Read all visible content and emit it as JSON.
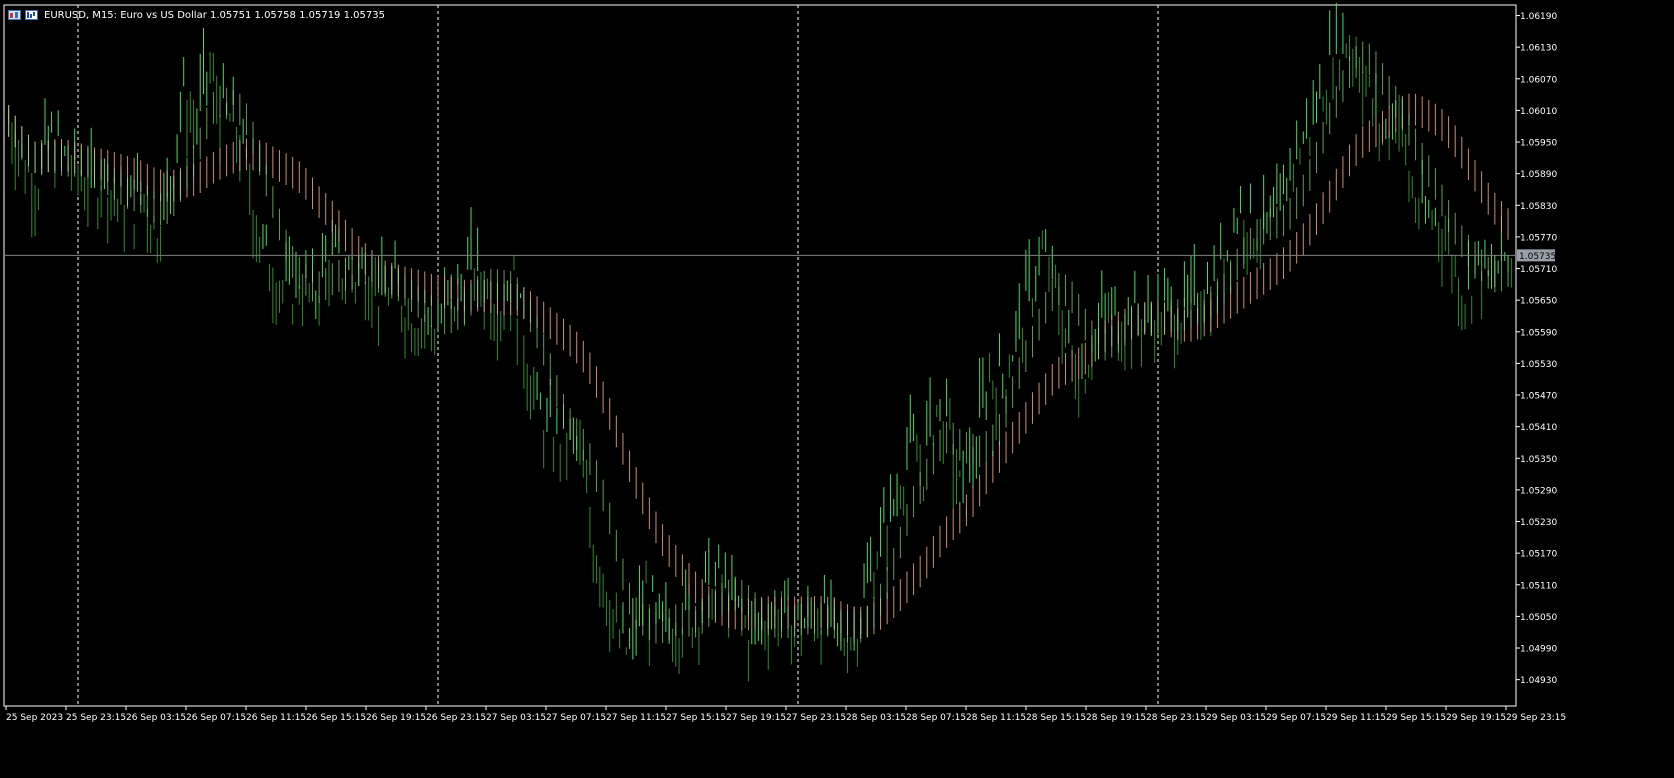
{
  "header": {
    "symbol_title": "EURUSD, M15:  Euro vs US Dollar  1.05751 1.05758 1.05719 1.05735"
  },
  "colors": {
    "background": "#000000",
    "axis": "#ffffff",
    "grid": "#ffffff",
    "bull_candle": "#4cd964",
    "bear_candle": "#2e8b2e",
    "ma_slow": "#f4a582",
    "ma_fast": "#8ee07a",
    "price_line": "#808080",
    "price_label_bg": "#9aa0aa"
  },
  "chart_data": {
    "type": "candlestick",
    "symbol": "EURUSD",
    "timeframe": "M15",
    "current_price": "1.05735",
    "ylim": [
      1.0488,
      1.0621
    ],
    "y_ticks": [
      "1.06190",
      "1.06130",
      "1.06070",
      "1.06010",
      "1.05950",
      "1.05890",
      "1.05830",
      "1.05770",
      "1.05710",
      "1.05650",
      "1.05590",
      "1.05530",
      "1.05470",
      "1.05410",
      "1.05350",
      "1.05290",
      "1.05230",
      "1.05170",
      "1.05110",
      "1.05050",
      "1.04990",
      "1.04930"
    ],
    "x_ticks": [
      "25 Sep 2023",
      "25 Sep 23:15",
      "26 Sep 03:15",
      "26 Sep 07:15",
      "26 Sep 11:15",
      "26 Sep 15:15",
      "26 Sep 19:15",
      "26 Sep 23:15",
      "27 Sep 03:15",
      "27 Sep 07:15",
      "27 Sep 11:15",
      "27 Sep 15:15",
      "27 Sep 19:15",
      "27 Sep 23:15",
      "28 Sep 03:15",
      "28 Sep 07:15",
      "28 Sep 11:15",
      "28 Sep 15:15",
      "28 Sep 19:15",
      "28 Sep 23:15",
      "29 Sep 03:15",
      "29 Sep 07:15",
      "29 Sep 11:15",
      "29 Sep 15:15",
      "29 Sep 19:15",
      "29 Sep 23:15"
    ],
    "day_separators": [
      "25 Sep 23:15",
      "26 Sep 23:15",
      "27 Sep 23:15",
      "28 Sep 23:15"
    ],
    "close_path": [
      [
        0,
        1.0599
      ],
      [
        4,
        1.0591
      ],
      [
        8,
        1.0587
      ],
      [
        12,
        1.0596
      ],
      [
        16,
        1.0592
      ],
      [
        20,
        1.0589
      ],
      [
        24,
        1.0586
      ],
      [
        28,
        1.0588
      ],
      [
        32,
        1.0584
      ],
      [
        36,
        1.0582
      ],
      [
        40,
        1.0585
      ],
      [
        44,
        1.0578
      ],
      [
        48,
        1.0586
      ],
      [
        52,
        1.0604
      ],
      [
        56,
        1.0598
      ],
      [
        60,
        1.0609
      ],
      [
        64,
        1.06
      ],
      [
        68,
        1.0598
      ],
      [
        72,
        1.0588
      ],
      [
        76,
        1.0575
      ],
      [
        80,
        1.057
      ],
      [
        84,
        1.0566
      ],
      [
        88,
        1.0569
      ],
      [
        92,
        1.0565
      ],
      [
        96,
        1.0574
      ],
      [
        100,
        1.0571
      ],
      [
        104,
        1.0569
      ],
      [
        108,
        1.0571
      ],
      [
        112,
        1.0565
      ],
      [
        116,
        1.0568
      ],
      [
        120,
        1.0563
      ],
      [
        124,
        1.0561
      ],
      [
        128,
        1.0559
      ],
      [
        132,
        1.0564
      ],
      [
        136,
        1.0567
      ],
      [
        140,
        1.0572
      ],
      [
        144,
        1.0567
      ],
      [
        148,
        1.0564
      ],
      [
        152,
        1.0568
      ],
      [
        156,
        1.0555
      ],
      [
        160,
        1.0543
      ],
      [
        164,
        1.0539
      ],
      [
        168,
        1.0538
      ],
      [
        172,
        1.0537
      ],
      [
        176,
        1.052
      ],
      [
        180,
        1.0512
      ],
      [
        184,
        1.05
      ],
      [
        188,
        1.0498
      ],
      [
        192,
        1.051
      ],
      [
        196,
        1.0502
      ],
      [
        200,
        1.0503
      ],
      [
        204,
        1.0505
      ],
      [
        208,
        1.0506
      ],
      [
        212,
        1.0512
      ],
      [
        216,
        1.0511
      ],
      [
        220,
        1.0506
      ],
      [
        224,
        1.0501
      ],
      [
        228,
        1.0503
      ],
      [
        232,
        1.0507
      ],
      [
        236,
        1.0504
      ],
      [
        240,
        1.0503
      ],
      [
        244,
        1.0506
      ],
      [
        248,
        1.0503
      ],
      [
        252,
        1.05
      ],
      [
        256,
        1.0503
      ],
      [
        260,
        1.0513
      ],
      [
        264,
        1.052
      ],
      [
        268,
        1.0527
      ],
      [
        272,
        1.0538
      ],
      [
        276,
        1.0533
      ],
      [
        280,
        1.0545
      ],
      [
        284,
        1.0541
      ],
      [
        288,
        1.0526
      ],
      [
        292,
        1.0536
      ],
      [
        296,
        1.0551
      ],
      [
        300,
        1.0549
      ],
      [
        304,
        1.0557
      ],
      [
        308,
        1.0565
      ],
      [
        312,
        1.0574
      ],
      [
        316,
        1.0568
      ],
      [
        320,
        1.0557
      ],
      [
        324,
        1.0551
      ],
      [
        328,
        1.0557
      ],
      [
        332,
        1.0563
      ],
      [
        336,
        1.0561
      ],
      [
        340,
        1.0561
      ],
      [
        344,
        1.0561
      ],
      [
        348,
        1.0563
      ],
      [
        352,
        1.0563
      ],
      [
        356,
        1.0562
      ],
      [
        360,
        1.0567
      ],
      [
        364,
        1.0567
      ],
      [
        368,
        1.0574
      ],
      [
        372,
        1.0583
      ],
      [
        376,
        1.0579
      ],
      [
        380,
        1.0578
      ],
      [
        384,
        1.058
      ],
      [
        388,
        1.0592
      ],
      [
        392,
        1.0596
      ],
      [
        396,
        1.0603
      ],
      [
        400,
        1.0611
      ],
      [
        404,
        1.0615
      ],
      [
        408,
        1.0612
      ],
      [
        412,
        1.0602
      ],
      [
        416,
        1.0596
      ],
      [
        420,
        1.0601
      ],
      [
        424,
        1.0586
      ],
      [
        428,
        1.058
      ],
      [
        432,
        1.0581
      ],
      [
        436,
        1.0574
      ],
      [
        440,
        1.0566
      ],
      [
        444,
        1.0572
      ],
      [
        448,
        1.0568
      ],
      [
        452,
        1.0573
      ],
      [
        455,
        1.0573
      ]
    ],
    "bars": 456
  }
}
